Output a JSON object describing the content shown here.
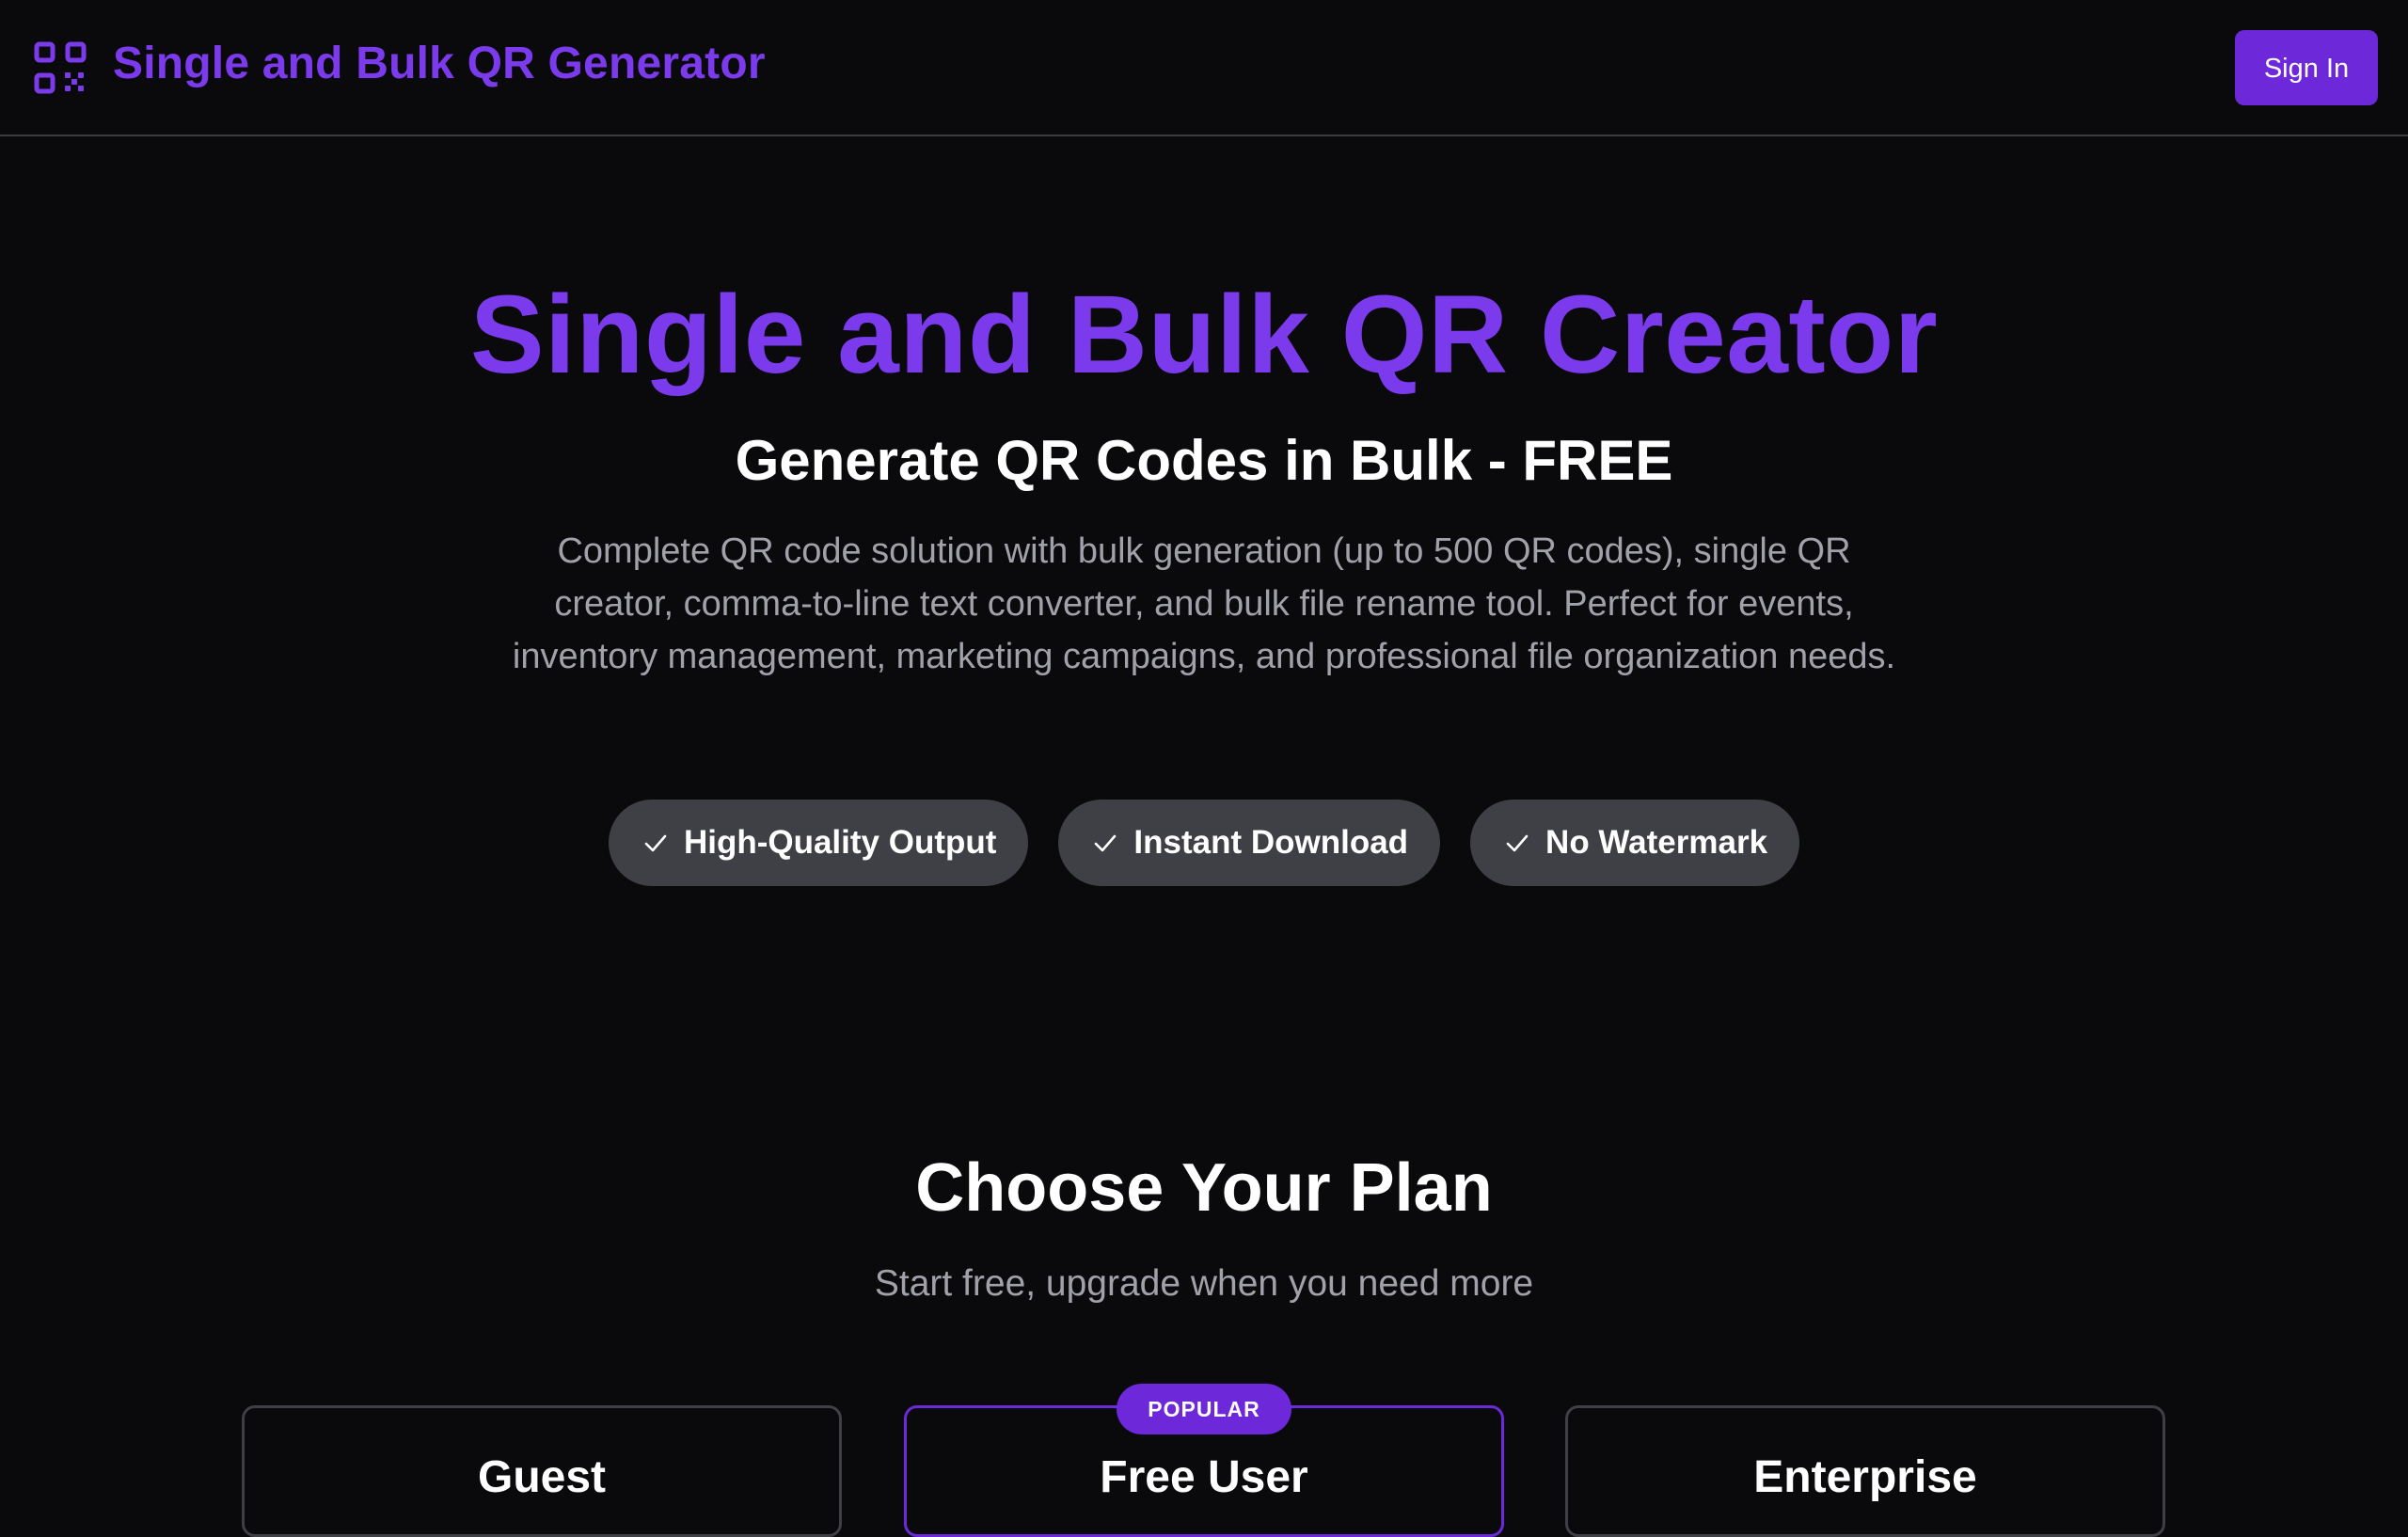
{
  "header": {
    "brand": "Single and Bulk QR Generator",
    "sign_in_label": "Sign In",
    "logo_icon": "qr-code-icon"
  },
  "hero": {
    "title": "Single and Bulk QR Creator",
    "subtitle": "Generate QR Codes in Bulk - FREE",
    "description": "Complete QR code solution with bulk generation (up to 500 QR codes), single QR creator, comma-to-line text converter, and bulk file rename tool. Perfect for events, inventory management, marketing campaigns, and professional file organization needs.",
    "features": [
      {
        "label": "High-Quality Output",
        "icon": "check-icon"
      },
      {
        "label": "Instant Download",
        "icon": "check-icon"
      },
      {
        "label": "No Watermark",
        "icon": "check-icon"
      }
    ]
  },
  "plans": {
    "title": "Choose Your Plan",
    "subtitle": "Start free, upgrade when you need more",
    "popular_badge": "POPULAR",
    "cards": [
      {
        "name": "Guest"
      },
      {
        "name": "Free User"
      },
      {
        "name": "Enterprise"
      }
    ]
  },
  "colors": {
    "accent": "#7c3aed",
    "button": "#6d28d9",
    "background": "#0a0a0c",
    "pill": "#3f3f46",
    "muted_text": "#a1a1aa"
  }
}
